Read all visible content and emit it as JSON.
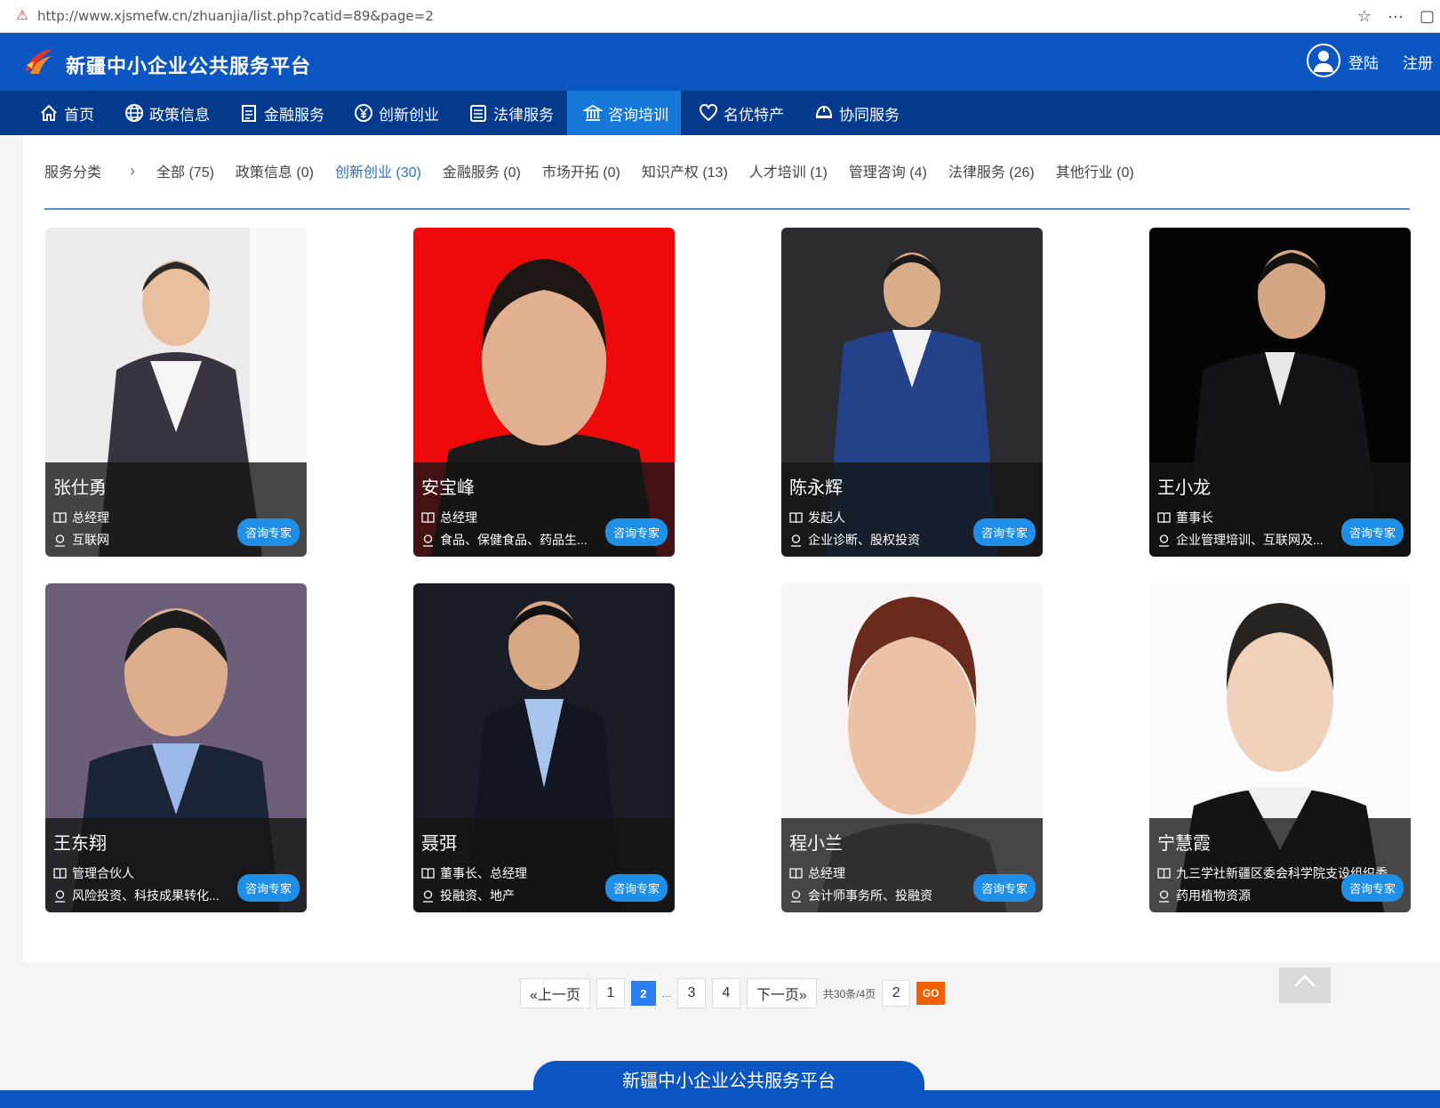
{
  "browser": {
    "url": "http://www.xjsmefw.cn/zhuanjia/list.php?catid=89&page=2"
  },
  "header": {
    "site_title": "新疆中小企业公共服务平台",
    "login": "登陆",
    "register": "注册"
  },
  "nav": {
    "items": [
      {
        "label": "首页",
        "icon": "home-icon"
      },
      {
        "label": "政策信息",
        "icon": "globe-icon"
      },
      {
        "label": "金融服务",
        "icon": "document-icon"
      },
      {
        "label": "创新创业",
        "icon": "yen-coin-icon"
      },
      {
        "label": "法律服务",
        "icon": "notepad-icon"
      },
      {
        "label": "咨询培训",
        "icon": "bank-icon",
        "active": true
      },
      {
        "label": "名优特产",
        "icon": "heart-icon"
      },
      {
        "label": "协同服务",
        "icon": "helmet-icon"
      }
    ]
  },
  "filter": {
    "label": "服务分类",
    "items": [
      {
        "label": "全部 (75)"
      },
      {
        "label": "政策信息 (0)"
      },
      {
        "label": "创新创业 (30)",
        "active": true
      },
      {
        "label": "金融服务 (0)"
      },
      {
        "label": "市场开拓 (0)"
      },
      {
        "label": "知识产权 (13)"
      },
      {
        "label": "人才培训 (1)"
      },
      {
        "label": "管理咨询 (4)"
      },
      {
        "label": "法律服务 (26)"
      },
      {
        "label": "其他行业 (0)"
      }
    ]
  },
  "experts": [
    {
      "name": "张仕勇",
      "title": "总经理",
      "area": "互联网",
      "button": "咨询专家"
    },
    {
      "name": "安宝峰",
      "title": "总经理",
      "area": "食品、保健食品、药品生...",
      "button": "咨询专家"
    },
    {
      "name": "陈永辉",
      "title": "发起人",
      "area": "企业诊断、股权投资",
      "button": "咨询专家"
    },
    {
      "name": "王小龙",
      "title": "董事长",
      "area": "企业管理培训、互联网及...",
      "button": "咨询专家"
    },
    {
      "name": "王东翔",
      "title": "管理合伙人",
      "area": "风险投资、科技成果转化...",
      "button": "咨询专家"
    },
    {
      "name": "聂弭",
      "title": "董事长、总经理",
      "area": "投融资、地产",
      "button": "咨询专家"
    },
    {
      "name": "程小兰",
      "title": "总经理",
      "area": "会计师事务所、投融资",
      "button": "咨询专家"
    },
    {
      "name": "宁慧霞",
      "title": "九三学社新疆区委会科学院支设组织委",
      "area": "药用植物资源",
      "button": "咨询专家"
    }
  ],
  "pagination": {
    "prev": "«上一页",
    "pages": [
      "1",
      "2",
      "...",
      "3",
      "4"
    ],
    "current": "2",
    "next": "下一页»",
    "total": "共30条/4页",
    "input_value": "2",
    "go": "GO"
  },
  "footer": {
    "title": "新疆中小企业公共服务平台"
  },
  "colors": {
    "header_blue": "#0b56c2",
    "nav_blue": "#053a8c",
    "active_tab": "#1678d8",
    "consult_button": "#1f8fe8",
    "go_button": "#f06000"
  }
}
